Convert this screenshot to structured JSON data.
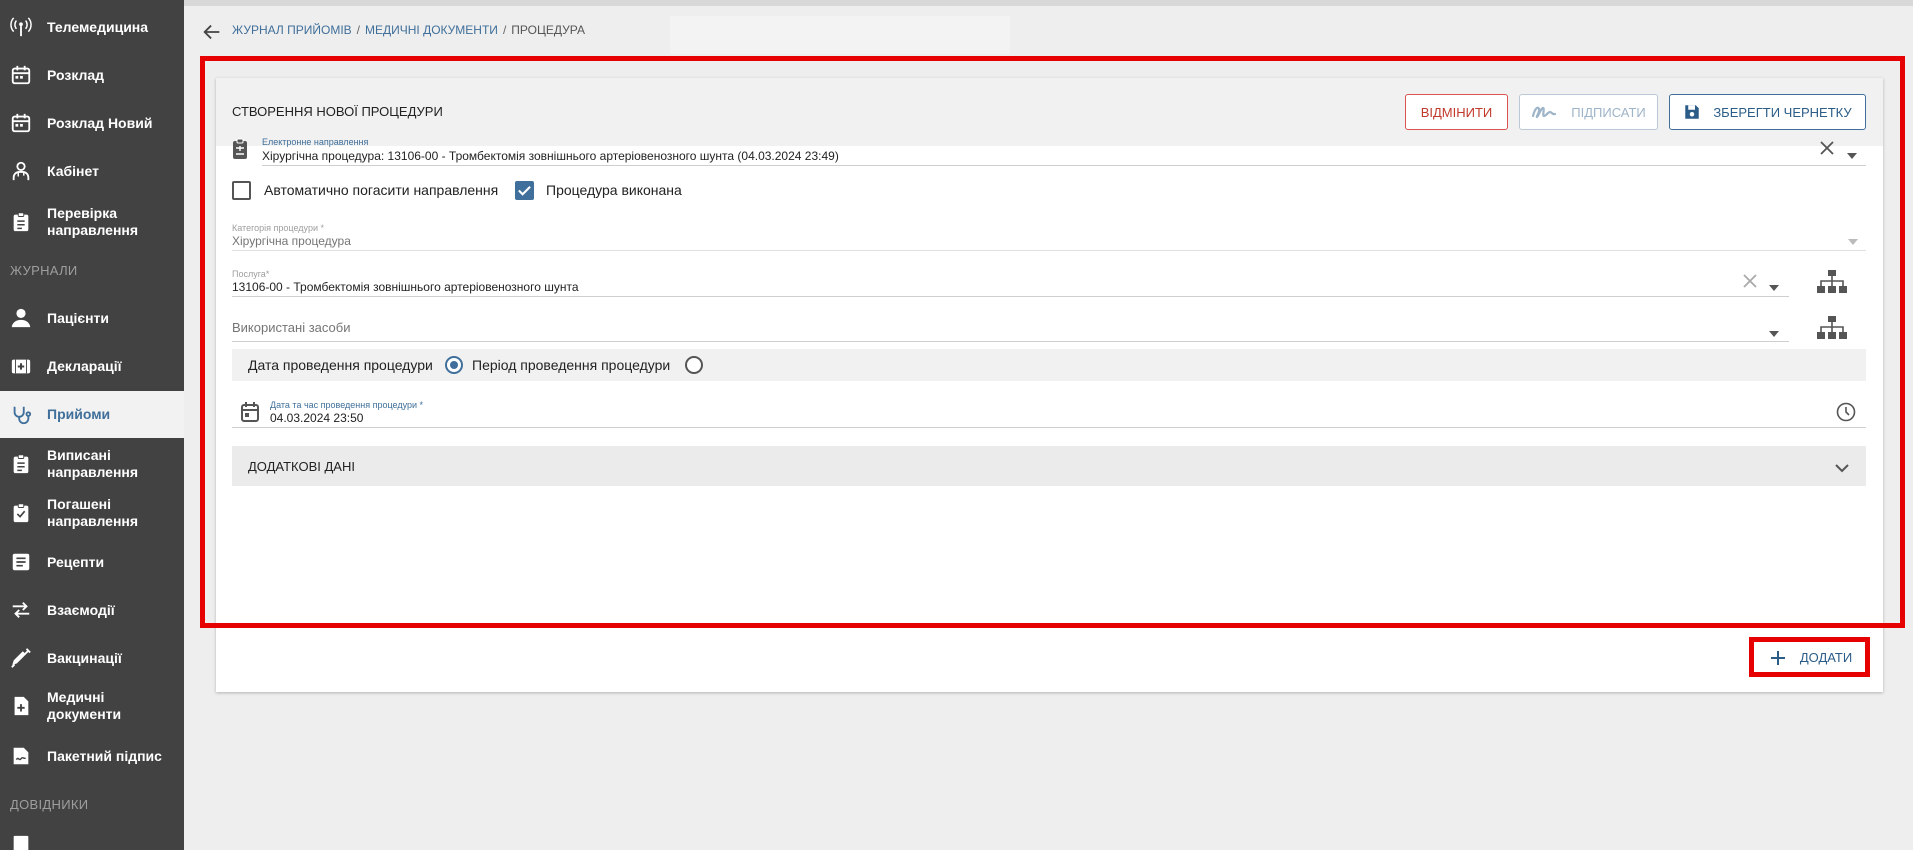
{
  "sidebar": {
    "items_top": [
      {
        "label": "Телемедицина",
        "icon": "antenna-icon"
      },
      {
        "label": "Розклад",
        "icon": "calendar-icon"
      },
      {
        "label": "Розклад Новий",
        "icon": "calendar-icon"
      },
      {
        "label": "Кабінет",
        "icon": "doctor-icon"
      },
      {
        "label": "Перевірка направлення",
        "icon": "clipboard-icon"
      }
    ],
    "section_journals": "ЖУРНАЛИ",
    "items_journals": [
      {
        "label": "Пацієнти",
        "icon": "person-icon"
      },
      {
        "label": "Декларації",
        "icon": "medical-case-icon"
      },
      {
        "label": "Прийоми",
        "icon": "stethoscope-icon",
        "active": true
      },
      {
        "label": "Виписані направлення",
        "icon": "clipboard-icon"
      },
      {
        "label": "Погашені направлення",
        "icon": "clipboard-icon"
      },
      {
        "label": "Рецепти",
        "icon": "list-icon"
      },
      {
        "label": "Взаємодії",
        "icon": "swap-icon"
      },
      {
        "label": "Вакцинації",
        "icon": "syringe-icon"
      },
      {
        "label": "Медичні документи",
        "icon": "document-plus-icon"
      },
      {
        "label": "Пакетний підпис",
        "icon": "signature-icon"
      }
    ],
    "section_refs": "ДОВІДНИКИ"
  },
  "breadcrumb": [
    "ЖУРНАЛ ПРИЙОМІВ",
    "МЕДИЧНІ ДОКУМЕНТИ",
    "ПРОЦЕДУРА"
  ],
  "form": {
    "title": "СТВОРЕННЯ НОВОЇ ПРОЦЕДУРИ",
    "cancel_label": "ВІДМІНИТИ",
    "sign_label": "ПІДПИСАТИ",
    "save_label": "ЗБЕРЕГТИ ЧЕРНЕТКУ",
    "referral_label": "Електронне направлення",
    "referral_value": "Хірургічна процедура: 13106-00 - Тромбектомія зовнішнього артеріовенозного шунта (04.03.2024 23:49)",
    "auto_close_label": "Автоматично погасити направлення",
    "auto_close_checked": false,
    "done_label": "Процедура виконана",
    "done_checked": true,
    "category_label": "Категорія процедури *",
    "category_value": "Хірургічна процедура",
    "service_label": "Послуга*",
    "service_value": "13106-00 - Тромбектомія зовнішнього артеріовенозного шунта",
    "tools_placeholder": "Використані засоби",
    "date_mode_label": "Дата проведення процедури",
    "period_mode_label": "Період проведення процедури",
    "datetime_label": "Дата та час проведення процедури *",
    "datetime_value": "04.03.2024 23:50",
    "extra_title": "ДОДАТКОВІ ДАНІ",
    "add_label": "ДОДАТИ"
  },
  "colors": {
    "sidebar": "#424242",
    "accent": "#3f6f9a",
    "cancel": "#d9534f",
    "highlight": "#e60000"
  }
}
